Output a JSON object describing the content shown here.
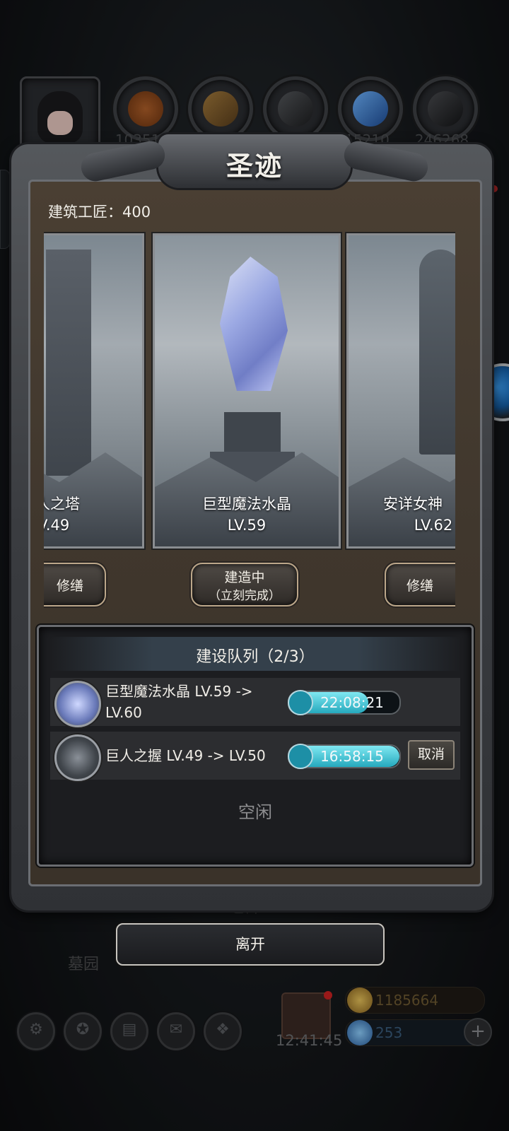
{
  "hud": {
    "resources": [
      {
        "icon": "meat-icon",
        "count": "103519",
        "color": "#8a4a1f"
      },
      {
        "icon": "wood-icon",
        "count": "413088",
        "color": "#7a5a2c"
      },
      {
        "icon": "stone-icon",
        "count": "371596",
        "color": "#3a3c40"
      },
      {
        "icon": "crystal-icon",
        "count": "15210",
        "color": "#3e7fd1"
      },
      {
        "icon": "iron-icon",
        "count": "246268",
        "color": "#2d2f33"
      }
    ],
    "bg_labels": {
      "warehouse": "仓库",
      "cemetery": "墓园"
    },
    "clock": "12:41:45",
    "gold": "1185664",
    "gems": "253",
    "bottom_buttons": [
      "gear-icon",
      "compass-icon",
      "scroll-icon",
      "mail-icon",
      "map-icon"
    ]
  },
  "modal": {
    "title": "圣迹",
    "builders": "建筑工匠：400",
    "cards": [
      {
        "name": "巨人之塔",
        "level": "LV.49",
        "button": "修缮"
      },
      {
        "name": "巨型魔法水晶",
        "level": "LV.59",
        "button_line1": "建造中",
        "button_line2": "（立刻完成）"
      },
      {
        "name": "安详女神",
        "level": "LV.62",
        "button": "修缮"
      }
    ],
    "queue": {
      "title": "建设队列（2/3）",
      "items": [
        {
          "text_line1": "巨型魔法水晶 LV.59 ->",
          "text_line2": "LV.60",
          "timer": "22:08:21",
          "progress": 0.72
        },
        {
          "text_line1": "巨人之握 LV.49 -> LV.50",
          "timer": "16:58:15",
          "progress": 1.0,
          "action": "取消"
        }
      ],
      "idle": "空闲"
    },
    "leave": "离开"
  },
  "colors": {
    "accent_cyan": "#25a9bd",
    "gold": "#c89a3a",
    "frame": "#55585c"
  }
}
